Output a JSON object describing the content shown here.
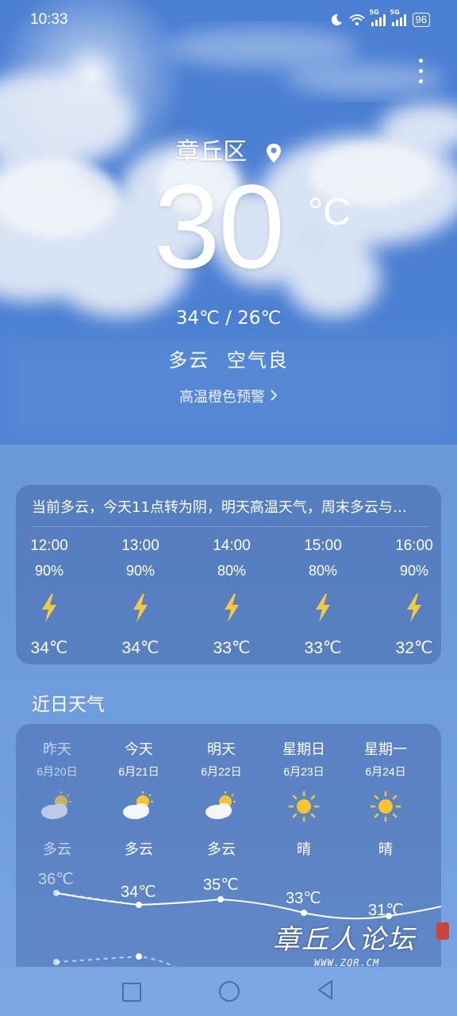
{
  "status_bar": {
    "time": "10:33",
    "network1": "5G",
    "network2": "5G",
    "battery": "96"
  },
  "current": {
    "location": "章丘区",
    "temperature": "30",
    "unit": "°C",
    "range": "34℃ / 26℃",
    "condition": "多云",
    "air_quality": "空气良",
    "alert": "高温橙色预警"
  },
  "hourly": {
    "summary": "当前多云，今天11点转为阴，明天高温天气，周末多云与…",
    "items": [
      {
        "time": "12:00",
        "precip": "90%",
        "icon": "thunder-icon",
        "temp": "34℃"
      },
      {
        "time": "13:00",
        "precip": "90%",
        "icon": "thunder-icon",
        "temp": "34℃"
      },
      {
        "time": "14:00",
        "precip": "80%",
        "icon": "thunder-icon",
        "temp": "33℃"
      },
      {
        "time": "15:00",
        "precip": "80%",
        "icon": "thunder-icon",
        "temp": "33℃"
      },
      {
        "time": "16:00",
        "precip": "90%",
        "icon": "thunder-icon",
        "temp": "32℃"
      }
    ]
  },
  "recent": {
    "title": "近日天气",
    "days": [
      {
        "name": "昨天",
        "date": "6月20日",
        "icon": "partly-cloudy-icon",
        "condition": "多云",
        "high": "36℃"
      },
      {
        "name": "今天",
        "date": "6月21日",
        "icon": "partly-cloudy-icon",
        "condition": "多云",
        "high": "34℃"
      },
      {
        "name": "明天",
        "date": "6月22日",
        "icon": "partly-cloudy-icon",
        "condition": "多云",
        "high": "35℃"
      },
      {
        "name": "星期日",
        "date": "6月23日",
        "icon": "sun-icon",
        "condition": "晴",
        "high": "33℃"
      },
      {
        "name": "星期一",
        "date": "6月24日",
        "icon": "sun-icon",
        "condition": "晴",
        "high": "31℃"
      }
    ]
  },
  "watermark": {
    "text": "章丘人论坛",
    "url": "WWW.ZQR.CM"
  },
  "colors": {
    "thunder": "#f5c842",
    "sun": "#f8c531"
  }
}
